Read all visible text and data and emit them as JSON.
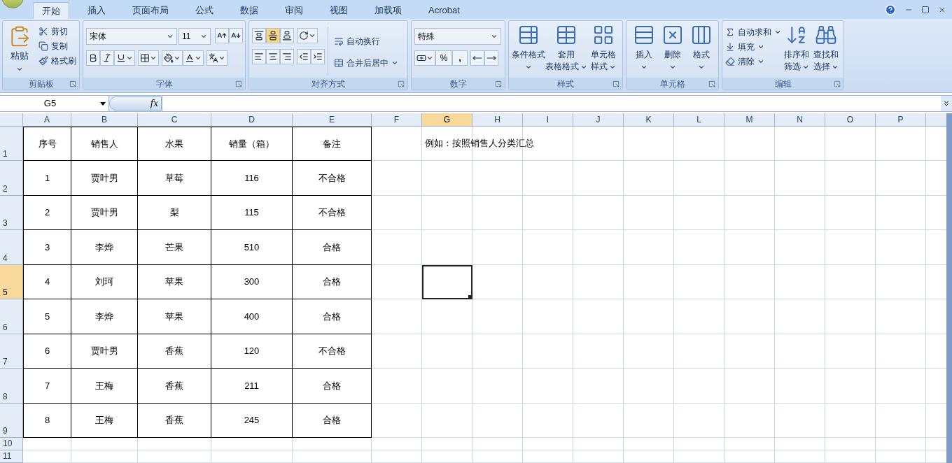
{
  "title_bar": {
    "tabs": [
      {
        "label": "开始",
        "selected": true
      },
      {
        "label": "插入",
        "selected": false
      },
      {
        "label": "页面布局",
        "selected": false
      },
      {
        "label": "公式",
        "selected": false
      },
      {
        "label": "数据",
        "selected": false
      },
      {
        "label": "审阅",
        "selected": false
      },
      {
        "label": "视图",
        "selected": false
      },
      {
        "label": "加载项",
        "selected": false
      },
      {
        "label": "Acrobat",
        "selected": false
      }
    ]
  },
  "ribbon": {
    "clipboard": {
      "title": "剪贴板",
      "paste": "粘贴",
      "actions": [
        "剪切",
        "复制",
        "格式刷"
      ]
    },
    "font": {
      "title": "字体",
      "font_name": "宋体",
      "font_size": "11"
    },
    "alignment": {
      "title": "对齐方式",
      "vertical": [
        {
          "selected": false
        },
        {
          "selected": true
        },
        {
          "selected": false
        }
      ],
      "wrap": "自动换行",
      "merge": "合并后居中"
    },
    "number": {
      "title": "数字",
      "format": "特殊",
      "percent": "%",
      "comma": ","
    },
    "styles": {
      "title": "样式",
      "buttons": [
        {
          "lines": [
            "条件格式"
          ]
        },
        {
          "lines": [
            "套用",
            "表格格式"
          ]
        },
        {
          "lines": [
            "单元格",
            "样式"
          ]
        }
      ]
    },
    "cells": {
      "title": "单元格",
      "buttons": [
        {
          "lines": [
            "插入"
          ]
        },
        {
          "lines": [
            "删除"
          ]
        },
        {
          "lines": [
            "格式"
          ]
        }
      ]
    },
    "editing": {
      "title": "编辑",
      "actions": [
        "自动求和",
        "填充",
        "清除"
      ],
      "buttons": [
        {
          "lines": [
            "排序和",
            "筛选"
          ]
        },
        {
          "lines": [
            "查找和",
            "选择"
          ]
        }
      ]
    }
  },
  "formula_bar": {
    "name_box": "G5",
    "function_label": "fx"
  },
  "sheet": {
    "columns": [
      {
        "label": "A",
        "selected": false
      },
      {
        "label": "B",
        "selected": false
      },
      {
        "label": "C",
        "selected": false
      },
      {
        "label": "D",
        "selected": false
      },
      {
        "label": "E",
        "selected": false
      },
      {
        "label": "F",
        "selected": false
      },
      {
        "label": "G",
        "selected": true
      },
      {
        "label": "H",
        "selected": false
      },
      {
        "label": "I",
        "selected": false
      },
      {
        "label": "J",
        "selected": false
      },
      {
        "label": "K",
        "selected": false
      },
      {
        "label": "L",
        "selected": false
      },
      {
        "label": "M",
        "selected": false
      },
      {
        "label": "N",
        "selected": false
      },
      {
        "label": "O",
        "selected": false
      },
      {
        "label": "P",
        "selected": false
      }
    ],
    "rows": [
      {
        "header": "1",
        "selected": false,
        "cells": [
          "序号",
          "销售人",
          "水果",
          "销量（箱）",
          "备注"
        ],
        "note": "例如：按照销售人分类汇总"
      },
      {
        "header": "2",
        "selected": false,
        "cells": [
          "1",
          "贾叶男",
          "草莓",
          "116",
          "不合格"
        ]
      },
      {
        "header": "3",
        "selected": false,
        "cells": [
          "2",
          "贾叶男",
          "梨",
          "115",
          "不合格"
        ]
      },
      {
        "header": "4",
        "selected": false,
        "cells": [
          "3",
          "李烨",
          "芒果",
          "510",
          "合格"
        ]
      },
      {
        "header": "5",
        "selected": true,
        "cells": [
          "4",
          "刘珂",
          "苹果",
          "300",
          "合格"
        ]
      },
      {
        "header": "6",
        "selected": false,
        "cells": [
          "5",
          "李烨",
          "苹果",
          "400",
          "合格"
        ]
      },
      {
        "header": "7",
        "selected": false,
        "cells": [
          "6",
          "贾叶男",
          "香蕉",
          "120",
          "不合格"
        ]
      },
      {
        "header": "8",
        "selected": false,
        "cells": [
          "7",
          "王梅",
          "香蕉",
          "211",
          "合格"
        ]
      },
      {
        "header": "9",
        "selected": false,
        "cells": [
          "8",
          "王梅",
          "香蕉",
          "245",
          "合格"
        ]
      },
      {
        "header": "10",
        "selected": false
      },
      {
        "header": "11",
        "selected": false
      }
    ]
  }
}
